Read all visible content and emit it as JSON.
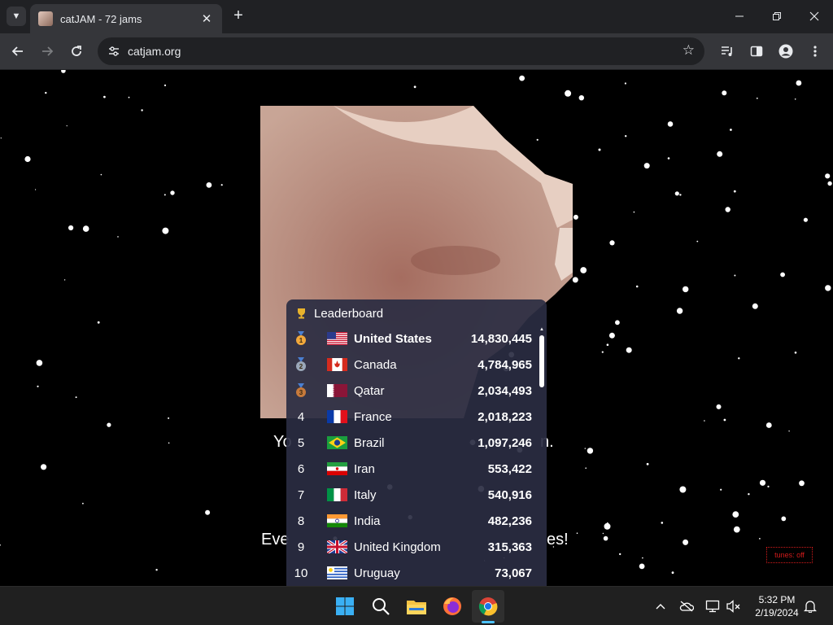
{
  "browser": {
    "tab_title": "catJAM - 72 jams",
    "url": "catjam.org",
    "icons": {
      "tab_search": "chevron-down-icon",
      "tab_close": "close-icon",
      "new_tab": "plus-icon",
      "minimize": "minimize-icon",
      "restore": "restore-icon",
      "close": "close-icon",
      "back": "back-arrow-icon",
      "forward": "forward-arrow-icon",
      "reload": "reload-icon",
      "site_info": "tune-icon",
      "bookmark": "star-icon",
      "media": "media-playlist-icon",
      "side_panel": "side-panel-icon",
      "profile": "profile-icon",
      "menu": "kebab-menu-icon"
    }
  },
  "page": {
    "line_top_left": "Yo",
    "line_top_right": "n.",
    "line_bottom_left": "Eve",
    "line_bottom_right": "es!",
    "tunes_button": "tunes: off"
  },
  "leaderboard": {
    "title": "Leaderboard",
    "rows": [
      {
        "rank": "1",
        "medal": "gold",
        "country": "United States",
        "count": "14,830,445"
      },
      {
        "rank": "2",
        "medal": "silver",
        "country": "Canada",
        "count": "4,784,965"
      },
      {
        "rank": "3",
        "medal": "bronze",
        "country": "Qatar",
        "count": "2,034,493"
      },
      {
        "rank": "4",
        "medal": "",
        "country": "France",
        "count": "2,018,223"
      },
      {
        "rank": "5",
        "medal": "",
        "country": "Brazil",
        "count": "1,097,246"
      },
      {
        "rank": "6",
        "medal": "",
        "country": "Iran",
        "count": "553,422"
      },
      {
        "rank": "7",
        "medal": "",
        "country": "Italy",
        "count": "540,916"
      },
      {
        "rank": "8",
        "medal": "",
        "country": "India",
        "count": "482,236"
      },
      {
        "rank": "9",
        "medal": "",
        "country": "United Kingdom",
        "count": "315,363"
      },
      {
        "rank": "10",
        "medal": "",
        "country": "Uruguay",
        "count": "73,067"
      }
    ]
  },
  "taskbar": {
    "apps": [
      "windows-start-icon",
      "search-icon",
      "file-explorer-icon",
      "firefox-icon",
      "chrome-icon"
    ],
    "tray": [
      "chevron-up-icon",
      "onedrive-offline-icon",
      "network-icon",
      "volume-muted-icon",
      "notification-bell-icon"
    ],
    "time": "5:32 PM",
    "date": "2/19/2024"
  },
  "colors": {
    "chrome_dark": "#202124",
    "chrome_toolbar": "#35363a",
    "leaderboard_bg": "#2a2c42",
    "tunes_red": "#d21b1b",
    "taskbar_bg": "#202020",
    "accent_blue": "#4cc2ff"
  }
}
